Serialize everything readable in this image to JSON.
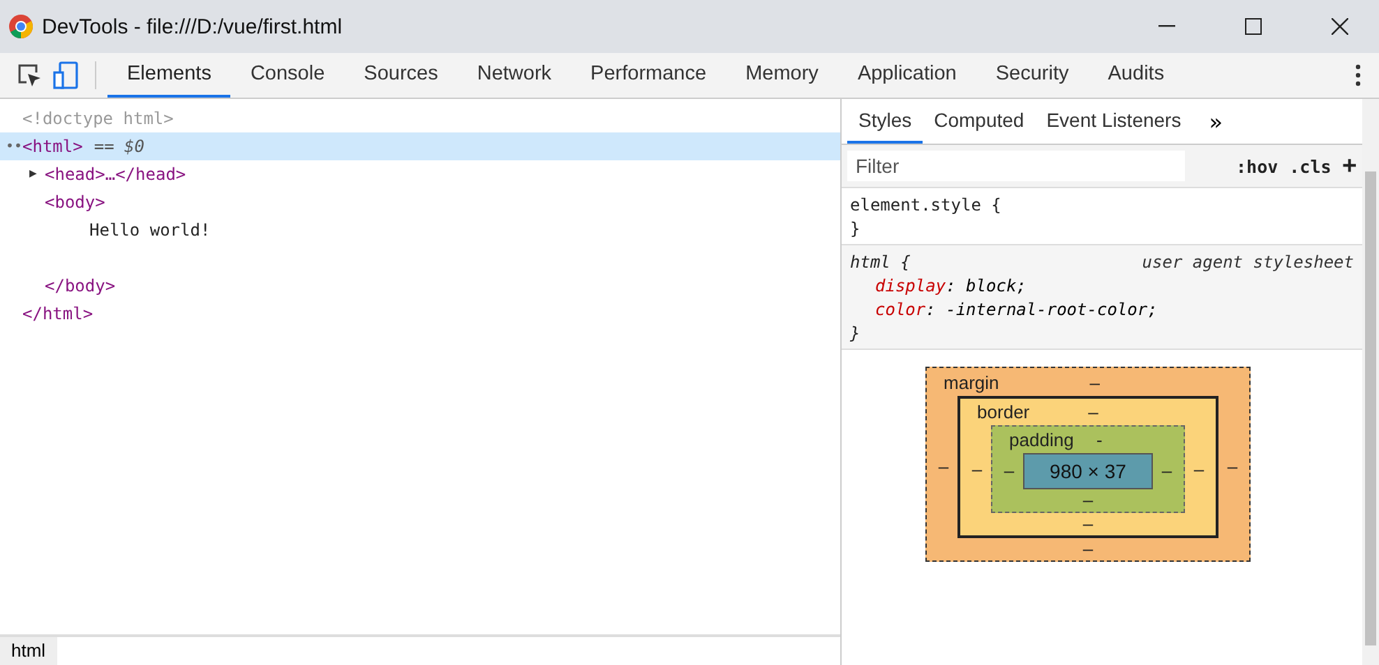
{
  "window": {
    "title": "DevTools - file:///D:/vue/first.html"
  },
  "tabs": [
    {
      "label": "Elements",
      "selected": true
    },
    {
      "label": "Console",
      "selected": false
    },
    {
      "label": "Sources",
      "selected": false
    },
    {
      "label": "Network",
      "selected": false
    },
    {
      "label": "Performance",
      "selected": false
    },
    {
      "label": "Memory",
      "selected": false
    },
    {
      "label": "Application",
      "selected": false
    },
    {
      "label": "Security",
      "selected": false
    },
    {
      "label": "Audits",
      "selected": false
    }
  ],
  "dom_tree": [
    {
      "kind": "doctype",
      "text": "<!doctype html>",
      "selected": false
    },
    {
      "kind": "element",
      "gutter": "••",
      "open": "<html>",
      "marker": "==",
      "ref": "$0",
      "selected": true,
      "close": "</html>",
      "children": [
        {
          "kind": "element",
          "toggle": "▶",
          "open": "<head>…</head>",
          "expanded": false,
          "selected": false
        },
        {
          "kind": "element",
          "open": "<body>",
          "selected": false,
          "close": "</body>",
          "children": [
            {
              "kind": "text",
              "text": "Hello world!",
              "selected": false
            }
          ]
        }
      ]
    }
  ],
  "breadcrumb": [
    "html"
  ],
  "sidebar_tabs": [
    {
      "label": "Styles",
      "selected": true
    },
    {
      "label": "Computed",
      "selected": false
    },
    {
      "label": "Event Listeners",
      "selected": false
    }
  ],
  "sidebar_more": "»",
  "filter": {
    "placeholder": "Filter"
  },
  "filter_buttons": [
    ":hov",
    ".cls",
    "+"
  ],
  "rules": [
    {
      "selector": "element.style {",
      "close": "}",
      "user_agent": false
    },
    {
      "selector": "html {",
      "source": "user agent stylesheet",
      "declarations": [
        {
          "property": "display",
          "colon": ":",
          "value": "block;"
        },
        {
          "property": "color",
          "colon": ":",
          "value": "-internal-root-color;"
        }
      ],
      "close": "}",
      "user_agent": true
    }
  ],
  "box_model": {
    "layers": [
      {
        "label": "margin",
        "top": "–",
        "left": "–"
      },
      {
        "label": "border",
        "top": "–",
        "left": "–"
      },
      {
        "label": "padding",
        "top": "-",
        "left": "–"
      }
    ],
    "content": "980 × 37",
    "right": [
      "–",
      "–",
      "–"
    ],
    "bottom": [
      "–",
      "–",
      "–"
    ]
  }
}
